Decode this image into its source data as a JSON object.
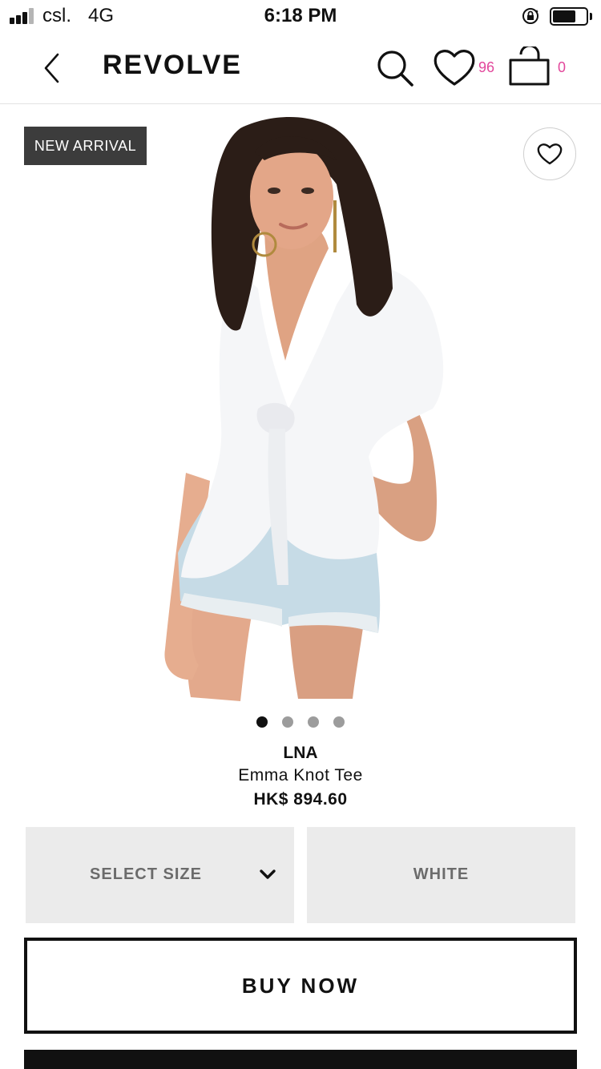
{
  "status_bar": {
    "carrier": "csl.",
    "network": "4G",
    "time": "6:18 PM",
    "signal_bars_filled": 3,
    "signal_bars_total": 4,
    "battery_level_fraction": 0.7
  },
  "header": {
    "brand": "REVOLVE",
    "wishlist_count": "96",
    "bag_count": "0",
    "accent_color": "#e2479b",
    "icons": [
      "chevron-left-icon",
      "search-icon",
      "heart-icon",
      "shopping-bag-icon"
    ]
  },
  "product": {
    "badge": "NEW ARRIVAL",
    "image_description_icon": "product-photo",
    "carousel_total": 4,
    "carousel_active_index": 0,
    "brand": "LNA",
    "name": "Emma Knot Tee",
    "price": "HK$ 894.60"
  },
  "options": {
    "size_label": "SELECT SIZE",
    "color_label": "WHITE"
  },
  "actions": {
    "buy_now": "BUY NOW"
  }
}
